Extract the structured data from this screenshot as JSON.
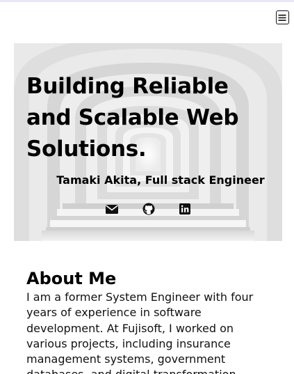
{
  "header": {
    "menu_icon": "hamburger-icon"
  },
  "hero": {
    "title": "Building Reliable and Scalable Web Solutions.",
    "subtitle": "Tamaki Akita, Full stack Engineer",
    "background": "white arched corridor with stairs (grayscale photo)",
    "socials": [
      {
        "icon": "envelope-icon"
      },
      {
        "icon": "github-icon"
      },
      {
        "icon": "linkedin-icon"
      }
    ]
  },
  "about": {
    "heading": "About Me",
    "text": "I am a former System Engineer with four years of experience in software development. At Fujisoft, I worked on various projects, including insurance management systems, government databases, and digital transformation"
  },
  "colors": {
    "page_background": "#ffffff",
    "text": "#000000",
    "hero_background": "#ececec"
  }
}
